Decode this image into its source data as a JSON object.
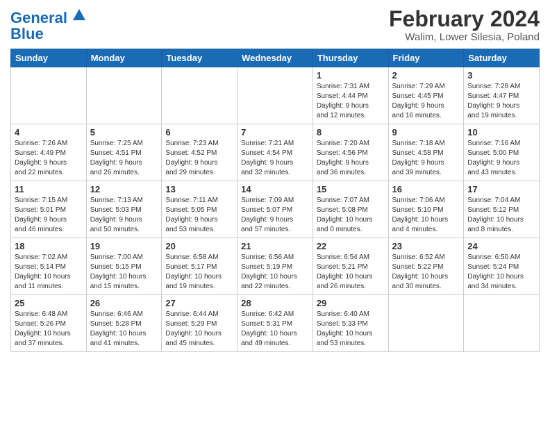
{
  "header": {
    "logo_line1": "General",
    "logo_line2": "Blue",
    "month_year": "February 2024",
    "location": "Walim, Lower Silesia, Poland"
  },
  "weekdays": [
    "Sunday",
    "Monday",
    "Tuesday",
    "Wednesday",
    "Thursday",
    "Friday",
    "Saturday"
  ],
  "weeks": [
    [
      {
        "day": "",
        "info": ""
      },
      {
        "day": "",
        "info": ""
      },
      {
        "day": "",
        "info": ""
      },
      {
        "day": "",
        "info": ""
      },
      {
        "day": "1",
        "info": "Sunrise: 7:31 AM\nSunset: 4:44 PM\nDaylight: 9 hours\nand 12 minutes."
      },
      {
        "day": "2",
        "info": "Sunrise: 7:29 AM\nSunset: 4:45 PM\nDaylight: 9 hours\nand 16 minutes."
      },
      {
        "day": "3",
        "info": "Sunrise: 7:28 AM\nSunset: 4:47 PM\nDaylight: 9 hours\nand 19 minutes."
      }
    ],
    [
      {
        "day": "4",
        "info": "Sunrise: 7:26 AM\nSunset: 4:49 PM\nDaylight: 9 hours\nand 22 minutes."
      },
      {
        "day": "5",
        "info": "Sunrise: 7:25 AM\nSunset: 4:51 PM\nDaylight: 9 hours\nand 26 minutes."
      },
      {
        "day": "6",
        "info": "Sunrise: 7:23 AM\nSunset: 4:52 PM\nDaylight: 9 hours\nand 29 minutes."
      },
      {
        "day": "7",
        "info": "Sunrise: 7:21 AM\nSunset: 4:54 PM\nDaylight: 9 hours\nand 32 minutes."
      },
      {
        "day": "8",
        "info": "Sunrise: 7:20 AM\nSunset: 4:56 PM\nDaylight: 9 hours\nand 36 minutes."
      },
      {
        "day": "9",
        "info": "Sunrise: 7:18 AM\nSunset: 4:58 PM\nDaylight: 9 hours\nand 39 minutes."
      },
      {
        "day": "10",
        "info": "Sunrise: 7:16 AM\nSunset: 5:00 PM\nDaylight: 9 hours\nand 43 minutes."
      }
    ],
    [
      {
        "day": "11",
        "info": "Sunrise: 7:15 AM\nSunset: 5:01 PM\nDaylight: 9 hours\nand 46 minutes."
      },
      {
        "day": "12",
        "info": "Sunrise: 7:13 AM\nSunset: 5:03 PM\nDaylight: 9 hours\nand 50 minutes."
      },
      {
        "day": "13",
        "info": "Sunrise: 7:11 AM\nSunset: 5:05 PM\nDaylight: 9 hours\nand 53 minutes."
      },
      {
        "day": "14",
        "info": "Sunrise: 7:09 AM\nSunset: 5:07 PM\nDaylight: 9 hours\nand 57 minutes."
      },
      {
        "day": "15",
        "info": "Sunrise: 7:07 AM\nSunset: 5:08 PM\nDaylight: 10 hours\nand 0 minutes."
      },
      {
        "day": "16",
        "info": "Sunrise: 7:06 AM\nSunset: 5:10 PM\nDaylight: 10 hours\nand 4 minutes."
      },
      {
        "day": "17",
        "info": "Sunrise: 7:04 AM\nSunset: 5:12 PM\nDaylight: 10 hours\nand 8 minutes."
      }
    ],
    [
      {
        "day": "18",
        "info": "Sunrise: 7:02 AM\nSunset: 5:14 PM\nDaylight: 10 hours\nand 11 minutes."
      },
      {
        "day": "19",
        "info": "Sunrise: 7:00 AM\nSunset: 5:15 PM\nDaylight: 10 hours\nand 15 minutes."
      },
      {
        "day": "20",
        "info": "Sunrise: 6:58 AM\nSunset: 5:17 PM\nDaylight: 10 hours\nand 19 minutes."
      },
      {
        "day": "21",
        "info": "Sunrise: 6:56 AM\nSunset: 5:19 PM\nDaylight: 10 hours\nand 22 minutes."
      },
      {
        "day": "22",
        "info": "Sunrise: 6:54 AM\nSunset: 5:21 PM\nDaylight: 10 hours\nand 26 minutes."
      },
      {
        "day": "23",
        "info": "Sunrise: 6:52 AM\nSunset: 5:22 PM\nDaylight: 10 hours\nand 30 minutes."
      },
      {
        "day": "24",
        "info": "Sunrise: 6:50 AM\nSunset: 5:24 PM\nDaylight: 10 hours\nand 34 minutes."
      }
    ],
    [
      {
        "day": "25",
        "info": "Sunrise: 6:48 AM\nSunset: 5:26 PM\nDaylight: 10 hours\nand 37 minutes."
      },
      {
        "day": "26",
        "info": "Sunrise: 6:46 AM\nSunset: 5:28 PM\nDaylight: 10 hours\nand 41 minutes."
      },
      {
        "day": "27",
        "info": "Sunrise: 6:44 AM\nSunset: 5:29 PM\nDaylight: 10 hours\nand 45 minutes."
      },
      {
        "day": "28",
        "info": "Sunrise: 6:42 AM\nSunset: 5:31 PM\nDaylight: 10 hours\nand 49 minutes."
      },
      {
        "day": "29",
        "info": "Sunrise: 6:40 AM\nSunset: 5:33 PM\nDaylight: 10 hours\nand 53 minutes."
      },
      {
        "day": "",
        "info": ""
      },
      {
        "day": "",
        "info": ""
      }
    ]
  ]
}
